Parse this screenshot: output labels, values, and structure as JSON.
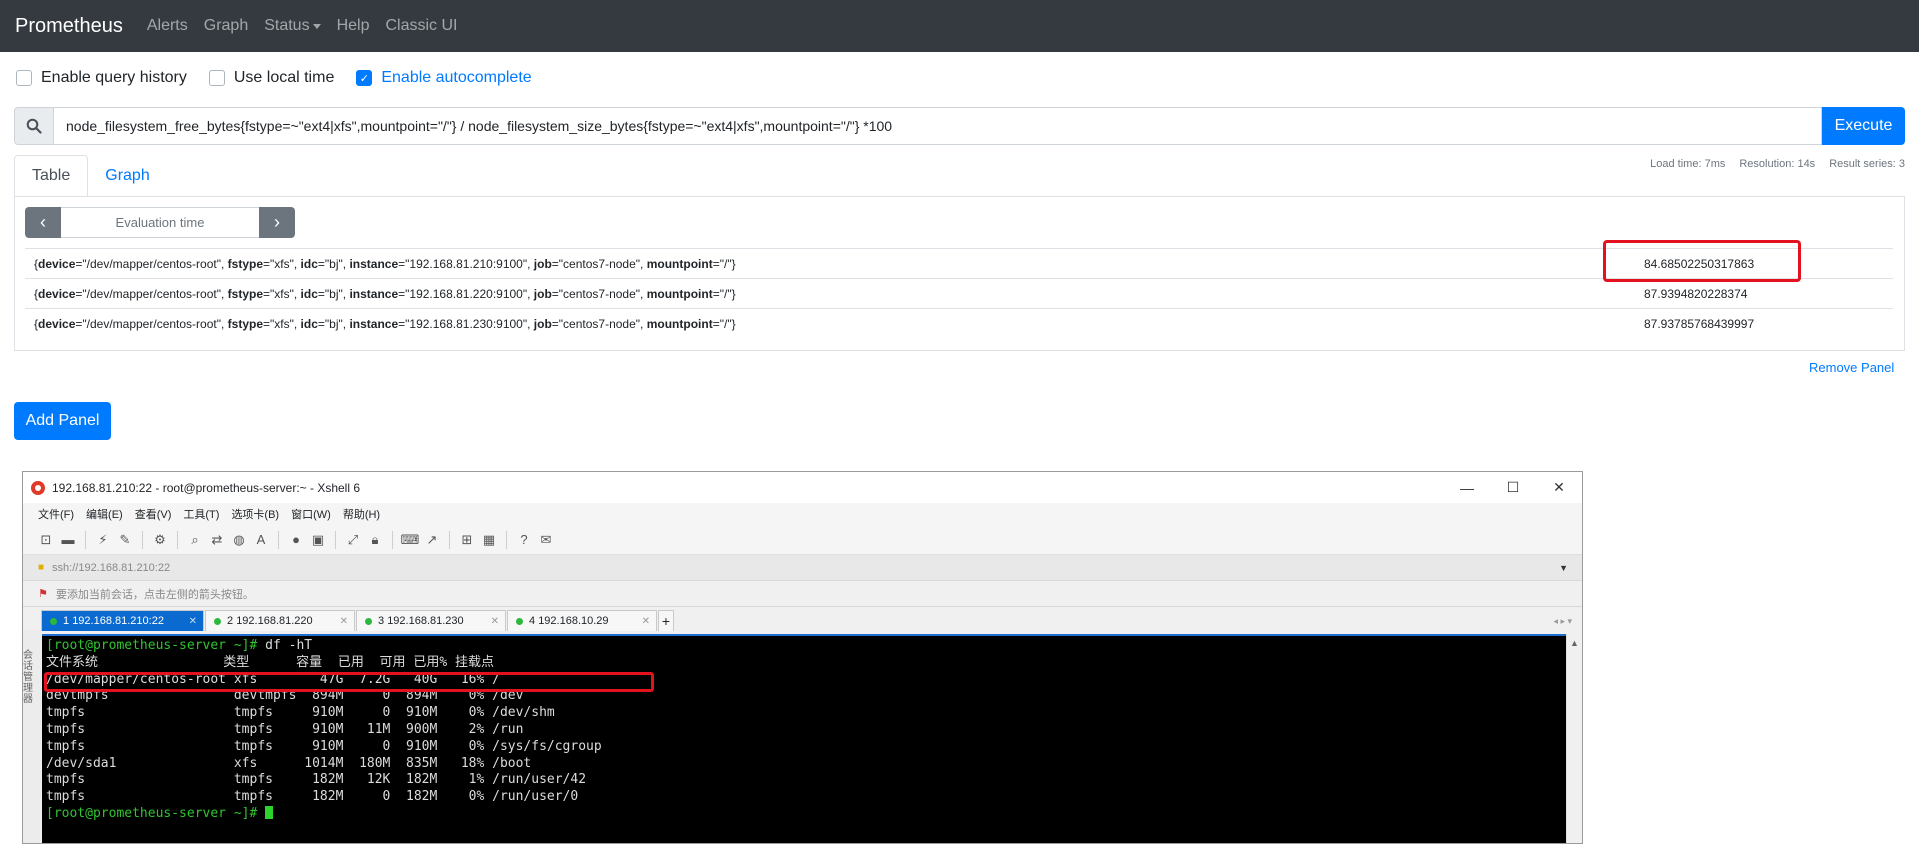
{
  "nav": {
    "brand": "Prometheus",
    "items": [
      "Alerts",
      "Graph",
      "Status",
      "Help",
      "Classic UI"
    ]
  },
  "options": {
    "query_history": "Enable query history",
    "local_time": "Use local time",
    "autocomplete": "Enable autocomplete"
  },
  "query": {
    "expr": "node_filesystem_free_bytes{fstype=~\"ext4|xfs\",mountpoint=\"/\"} / node_filesystem_size_bytes{fstype=~\"ext4|xfs\",mountpoint=\"/\"} *100",
    "execute": "Execute"
  },
  "tabs": [
    "Table",
    "Graph"
  ],
  "stats": {
    "load_time": "Load time: 7ms",
    "resolution": "Resolution: 14s",
    "series": "Result series: 3"
  },
  "eval": {
    "label": "Evaluation time"
  },
  "results": [
    {
      "device": "\"/dev/mapper/centos-root\"",
      "fstype": "\"xfs\"",
      "idc": "\"bj\"",
      "instance": "\"192.168.81.210:9100\"",
      "job": "\"centos7-node\"",
      "mountpoint": "\"/\"",
      "value": "84.68502250317863"
    },
    {
      "device": "\"/dev/mapper/centos-root\"",
      "fstype": "\"xfs\"",
      "idc": "\"bj\"",
      "instance": "\"192.168.81.220:9100\"",
      "job": "\"centos7-node\"",
      "mountpoint": "\"/\"",
      "value": "87.9394820228374"
    },
    {
      "device": "\"/dev/mapper/centos-root\"",
      "fstype": "\"xfs\"",
      "idc": "\"bj\"",
      "instance": "\"192.168.81.230:9100\"",
      "job": "\"centos7-node\"",
      "mountpoint": "\"/\"",
      "value": "87.93785768439997"
    }
  ],
  "remove_panel": "Remove Panel",
  "add_panel": "Add Panel",
  "xshell": {
    "title": "192.168.81.210:22 - root@prometheus-server:~ - Xshell 6",
    "menu": [
      "文件(F)",
      "编辑(E)",
      "查看(V)",
      "工具(T)",
      "选项卡(B)",
      "窗口(W)",
      "帮助(H)"
    ],
    "address": "ssh://192.168.81.210:22",
    "hint": "要添加当前会话，点击左侧的箭头按钮。",
    "side_label": "会话管理器",
    "tabs": [
      {
        "num": "1",
        "label": "192.168.81.210:22"
      },
      {
        "num": "2",
        "label": "192.168.81.220"
      },
      {
        "num": "3",
        "label": "192.168.81.230"
      },
      {
        "num": "4",
        "label": "192.168.10.29"
      }
    ],
    "terminal": {
      "prompt": "[root@prometheus-server ~]#",
      "command": " df -hT",
      "header": "文件系统                类型      容量  已用  可用 已用% 挂载点",
      "lines": [
        "/dev/mapper/centos-root xfs        47G  7.2G   40G   16% /",
        "devtmpfs                devtmpfs  894M     0  894M    0% /dev",
        "tmpfs                   tmpfs     910M     0  910M    0% /dev/shm",
        "tmpfs                   tmpfs     910M   11M  900M    2% /run",
        "tmpfs                   tmpfs     910M     0  910M    0% /sys/fs/cgroup",
        "/dev/sda1               xfs      1014M  180M  835M   18% /boot",
        "tmpfs                   tmpfs     182M   12K  182M    1% /run/user/42",
        "tmpfs                   tmpfs     182M     0  182M    0% /run/user/0"
      ],
      "final_prompt": "[root@prometheus-server ~]#"
    }
  }
}
